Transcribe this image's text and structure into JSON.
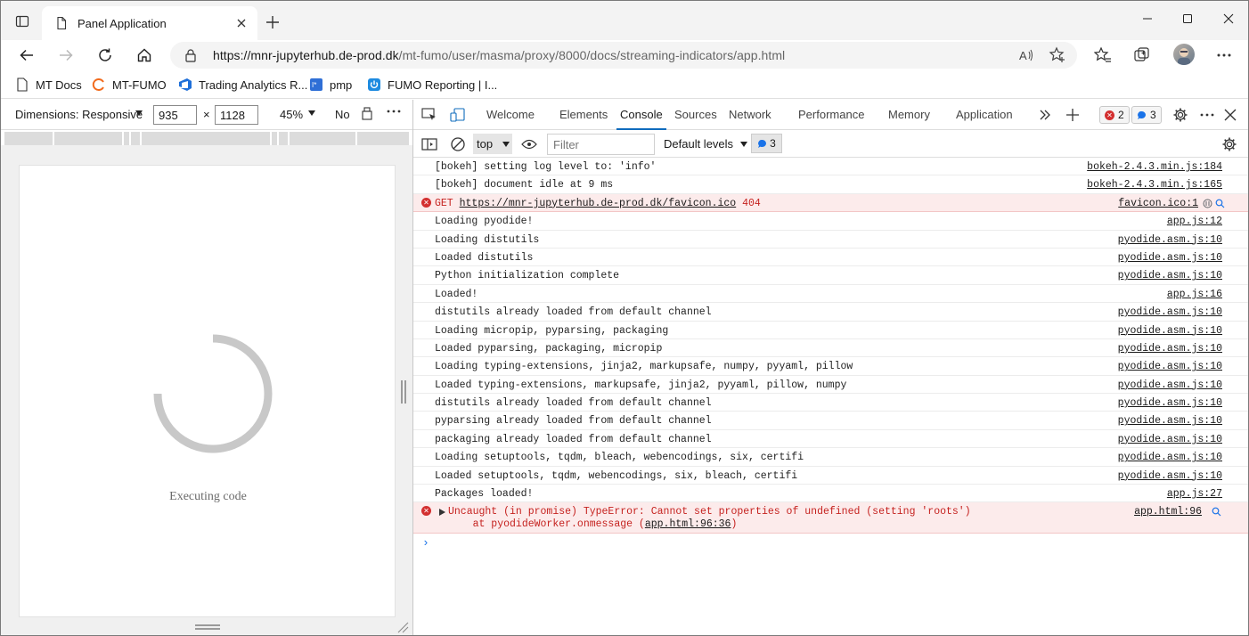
{
  "browser": {
    "tab_title": "Panel Application",
    "url_host": "https://mnr-jupyterhub.de-prod.dk",
    "url_path": "/mt-fumo/user/masma/proxy/8000/docs/streaming-indicators/app.html"
  },
  "favorites": [
    {
      "label": "MT Docs",
      "icon": "document-icon"
    },
    {
      "label": "MT-FUMO",
      "icon": "circle-logo-icon"
    },
    {
      "label": "Trading Analytics R...",
      "icon": "azure-devops-icon"
    },
    {
      "label": "pmp",
      "icon": "pmp-logo-icon"
    },
    {
      "label": "FUMO Reporting | I...",
      "icon": "power-icon"
    }
  ],
  "device_toolbar": {
    "dimensions_label": "Dimensions: Responsive",
    "width": "935",
    "times": "×",
    "height": "1128",
    "zoom": "45%",
    "throttle": "No"
  },
  "viewport": {
    "status_text": "Executing code"
  },
  "devtools": {
    "tabs": [
      "Welcome",
      "Elements",
      "Console",
      "Sources",
      "Network",
      "Performance",
      "Memory",
      "Application"
    ],
    "active_tab": "Console",
    "error_count": "2",
    "message_count": "3"
  },
  "console_toolbar": {
    "context": "top",
    "filter_placeholder": "Filter",
    "levels": "Default levels",
    "badge_count": "3"
  },
  "console": {
    "rows": [
      {
        "msg": "[bokeh] setting log level to: 'info'",
        "src": "bokeh-2.4.3.min.js:184"
      },
      {
        "msg": "[bokeh] document idle at 9 ms",
        "src": "bokeh-2.4.3.min.js:165"
      },
      {
        "msg": "Loading pyodide!",
        "src": "app.js:12"
      },
      {
        "msg": "Loading distutils",
        "src": "pyodide.asm.js:10"
      },
      {
        "msg": "Loaded distutils",
        "src": "pyodide.asm.js:10"
      },
      {
        "msg": "Python initialization complete",
        "src": "pyodide.asm.js:10"
      },
      {
        "msg": "Loaded!",
        "src": "app.js:16"
      },
      {
        "msg": "distutils already loaded from default channel",
        "src": "pyodide.asm.js:10"
      },
      {
        "msg": "Loading micropip, pyparsing, packaging",
        "src": "pyodide.asm.js:10"
      },
      {
        "msg": "Loaded pyparsing, packaging, micropip",
        "src": "pyodide.asm.js:10"
      },
      {
        "msg": "Loading typing-extensions, jinja2, markupsafe, numpy, pyyaml, pillow",
        "src": "pyodide.asm.js:10"
      },
      {
        "msg": "Loaded typing-extensions, markupsafe, jinja2, pyyaml, pillow, numpy",
        "src": "pyodide.asm.js:10"
      },
      {
        "msg": "distutils already loaded from default channel",
        "src": "pyodide.asm.js:10"
      },
      {
        "msg": "pyparsing already loaded from default channel",
        "src": "pyodide.asm.js:10"
      },
      {
        "msg": "packaging already loaded from default channel",
        "src": "pyodide.asm.js:10"
      },
      {
        "msg": "Loading setuptools, tqdm, bleach, webencodings, six, certifi",
        "src": "pyodide.asm.js:10"
      },
      {
        "msg": "Loaded setuptools, tqdm, webencodings, six, bleach, certifi",
        "src": "pyodide.asm.js:10"
      },
      {
        "msg": "Packages loaded!",
        "src": "app.js:27"
      }
    ],
    "error_get": {
      "method": "GET",
      "url": "https://mnr-jupyterhub.de-prod.dk/favicon.ico",
      "status": "404",
      "src": "favicon.ico:1"
    },
    "error_uncaught": {
      "msg": "Uncaught (in promise) TypeError: Cannot set properties of undefined (setting 'roots')",
      "stack_prefix": "    at pyodideWorker.onmessage (",
      "stack_link": "app.html:96:36",
      "stack_suffix": ")",
      "src": "app.html:96"
    },
    "prompt": "›"
  },
  "colors": {
    "accent": "#0f6cbd",
    "error": "#d32f2f",
    "error_bg": "#fcebeb"
  }
}
